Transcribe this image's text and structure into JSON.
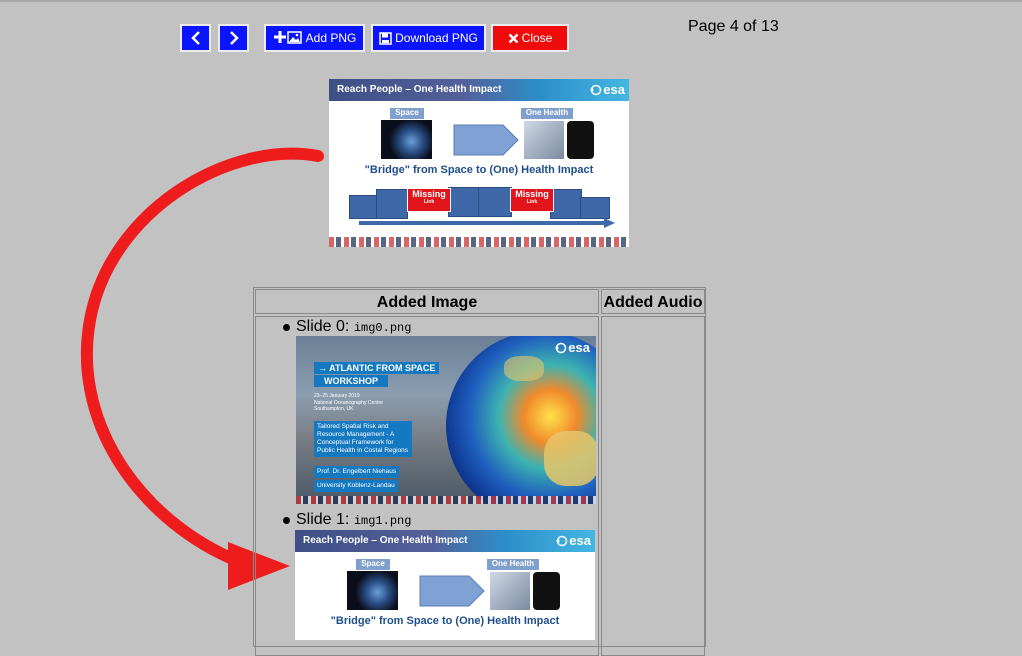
{
  "toolbar": {
    "prev_icon": "chevron-left-icon",
    "next_icon": "chevron-right-icon",
    "add_png_label": "Add PNG",
    "add_png_icon": "add-image-icon",
    "download_png_label": "Download PNG",
    "download_icon": "floppy-disk-icon",
    "close_label": "Close",
    "close_icon": "x-icon"
  },
  "page_indicator": "Page 4 of 13",
  "colors": {
    "blue_button": "#0a14ff",
    "red_button": "#f00b0b",
    "background": "#c2c2c2",
    "arrow": "#ee1c1c"
  },
  "current_slide": {
    "title": "Reach People – One Health Impact",
    "logo": "esa",
    "left_tag": "Space",
    "right_tag": "One Health",
    "bridge_text": "\"Bridge\" from Space to (One) Health Impact",
    "missing_label": "Missing",
    "link_label": "Link"
  },
  "table": {
    "col_image": "Added Image",
    "col_audio": "Added Audio",
    "items": [
      {
        "label": "Slide 0: ",
        "file": "img0.png"
      },
      {
        "label": "Slide 1: ",
        "file": "img1.png"
      }
    ]
  },
  "slide0": {
    "logo": "esa",
    "ws_line1": "→ ATLANTIC FROM SPACE",
    "ws_line2": "WORKSHOP",
    "date": "23–25 January 2019",
    "venue1": "National Oceanography Centre",
    "venue2": "Southampton, UK",
    "subject": "Tailored Spatial Risk and Resource Management - A Conceptual Framework for Public Health in Costal Regions",
    "author": "Prof. Dr. Engelbert Niehaus",
    "university": "University Koblenz-Landau"
  }
}
